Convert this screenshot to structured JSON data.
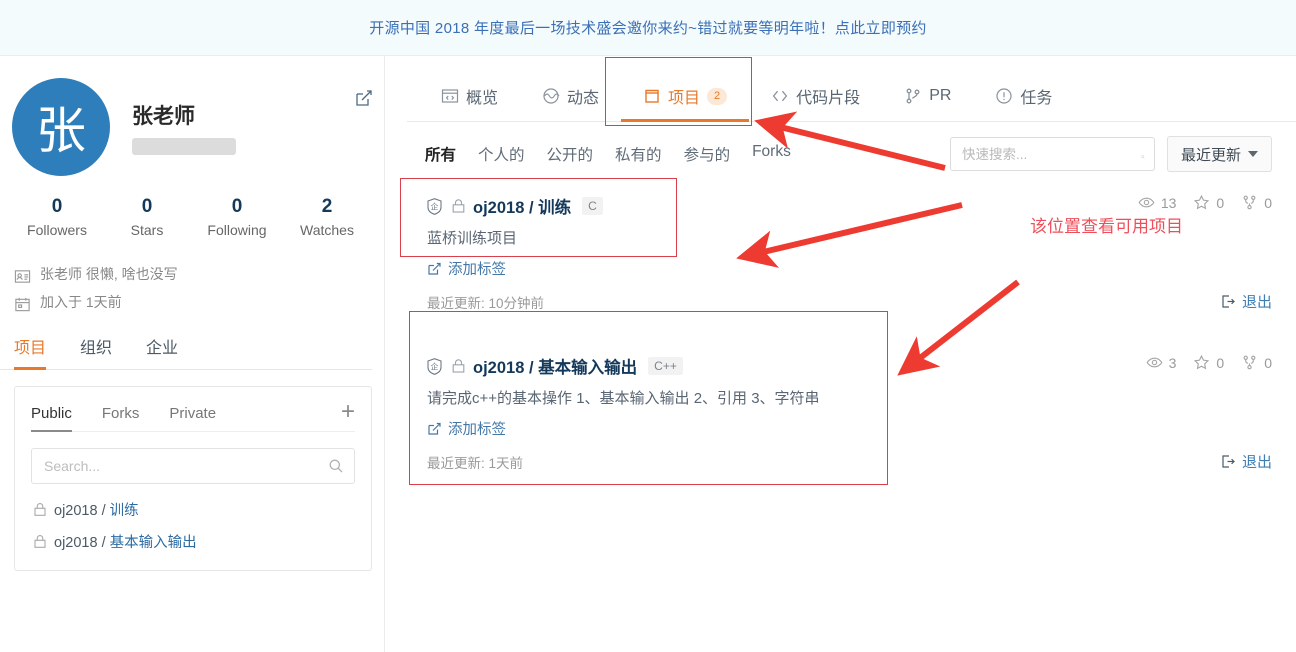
{
  "banner": {
    "text": "开源中国 2018 年度最后一场技术盛会邀你来约~错过就要等明年啦！点此立即预约"
  },
  "profile": {
    "avatar_initial": "张",
    "avatar_color": "#2e7ebb",
    "name": "张老师",
    "username_redacted": true,
    "edit_icon": "edit-pencil-icon",
    "stats": [
      {
        "num": "0",
        "label": "Followers"
      },
      {
        "num": "0",
        "label": "Stars"
      },
      {
        "num": "0",
        "label": "Following"
      },
      {
        "num": "2",
        "label": "Watches"
      }
    ],
    "bio": [
      {
        "icon": "profile-card-icon",
        "text": "张老师 很懒, 啥也没写"
      },
      {
        "icon": "calendar-icon",
        "text": "加入于 1天前"
      }
    ]
  },
  "sidebar": {
    "tabs": [
      {
        "label": "项目",
        "active": true
      },
      {
        "label": "组织",
        "active": false
      },
      {
        "label": "企业",
        "active": false
      }
    ],
    "panel": {
      "tabs": [
        {
          "label": "Public",
          "active": true
        },
        {
          "label": "Forks",
          "active": false
        },
        {
          "label": "Private",
          "active": false
        }
      ],
      "add_icon": "plus-icon",
      "search_placeholder": "Search...",
      "search_value": "",
      "search_icon": "search-icon",
      "repos": [
        {
          "icon": "lock-icon",
          "owner": "oj2018",
          "sep": "/",
          "name": "训练"
        },
        {
          "icon": "lock-icon",
          "owner": "oj2018",
          "sep": "/",
          "name": "基本输入输出"
        }
      ]
    }
  },
  "main": {
    "tabs": [
      {
        "label": "概览",
        "icon": "overview-icon",
        "active": false,
        "count": ""
      },
      {
        "label": "动态",
        "icon": "activity-icon",
        "active": false,
        "count": ""
      },
      {
        "label": "项目",
        "icon": "projects-icon",
        "active": true,
        "count": "2"
      },
      {
        "label": "代码片段",
        "icon": "code-snippet-icon",
        "active": false,
        "count": ""
      },
      {
        "label": "PR",
        "icon": "pull-request-icon",
        "active": false,
        "count": ""
      },
      {
        "label": "任务",
        "icon": "issue-icon",
        "active": false,
        "count": ""
      }
    ],
    "filters": [
      {
        "label": "所有",
        "active": true
      },
      {
        "label": "个人的",
        "active": false
      },
      {
        "label": "公开的",
        "active": false
      },
      {
        "label": "私有的",
        "active": false
      },
      {
        "label": "参与的",
        "active": false
      },
      {
        "label": "Forks",
        "active": false
      }
    ],
    "quick_search": {
      "placeholder": "快速搜索...",
      "value": "",
      "icon": "search-icon"
    },
    "sort": {
      "label": "最近更新",
      "icon": "chevron-down-icon"
    },
    "projects": [
      {
        "enterprise_icon": "enterprise-badge-icon",
        "lock_icon": "lock-icon",
        "owner": "oj2018",
        "sep": "/",
        "name": "训练",
        "language": "C",
        "description": "蓝桥训练项目",
        "add_tag_label": "添加标签",
        "updated": "最近更新: 10分钟前",
        "quit_label": "退出",
        "watches": "13",
        "stars": "0",
        "forks": "0"
      },
      {
        "enterprise_icon": "enterprise-badge-icon",
        "lock_icon": "lock-icon",
        "owner": "oj2018",
        "sep": "/",
        "name": "基本输入输出",
        "language": "C++",
        "description": "请完成c++的基本操作 1、基本输入输出 2、引用 3、字符串",
        "add_tag_label": "添加标签",
        "updated": "最近更新: 1天前",
        "quit_label": "退出",
        "watches": "3",
        "stars": "0",
        "forks": "0"
      }
    ]
  },
  "annotations": {
    "color": "#ef4e5a",
    "note_text": "该位置查看可用项目"
  }
}
